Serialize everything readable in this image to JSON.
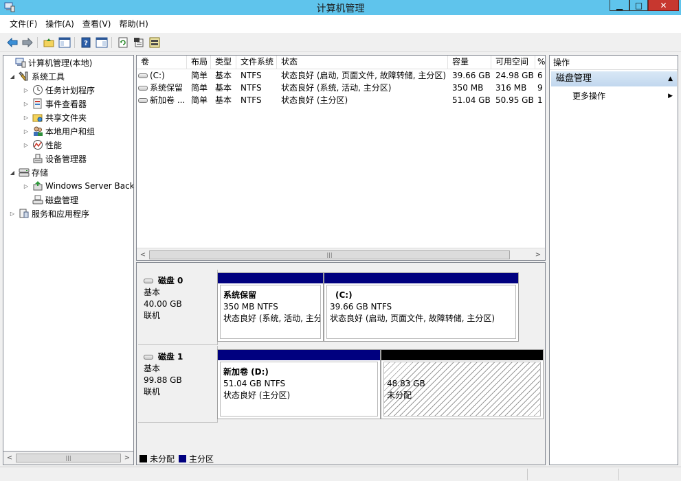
{
  "window": {
    "title": "计算机管理"
  },
  "menu": [
    "文件(F)",
    "操作(A)",
    "查看(V)",
    "帮助(H)"
  ],
  "tree": {
    "items": [
      {
        "label": "计算机管理(本地)",
        "level": 0,
        "expander": "",
        "icon": "computer-management-icon"
      },
      {
        "label": "系统工具",
        "level": 1,
        "expander": "◢",
        "icon": "system-tools-icon"
      },
      {
        "label": "任务计划程序",
        "level": 2,
        "expander": "▷",
        "icon": "task-scheduler-icon"
      },
      {
        "label": "事件查看器",
        "level": 2,
        "expander": "▷",
        "icon": "event-viewer-icon"
      },
      {
        "label": "共享文件夹",
        "level": 2,
        "expander": "▷",
        "icon": "shared-folders-icon"
      },
      {
        "label": "本地用户和组",
        "level": 2,
        "expander": "▷",
        "icon": "local-users-icon"
      },
      {
        "label": "性能",
        "level": 2,
        "expander": "▷",
        "icon": "performance-icon"
      },
      {
        "label": "设备管理器",
        "level": 2,
        "expander": "",
        "icon": "device-manager-icon"
      },
      {
        "label": "存储",
        "level": 1,
        "expander": "◢",
        "icon": "storage-icon"
      },
      {
        "label": "Windows Server Back",
        "level": 2,
        "expander": "▷",
        "icon": "windows-server-backup-icon"
      },
      {
        "label": "磁盘管理",
        "level": 2,
        "expander": "",
        "icon": "disk-management-icon",
        "selected": true
      },
      {
        "label": "服务和应用程序",
        "level": 1,
        "expander": "▷",
        "icon": "services-applications-icon"
      }
    ]
  },
  "volumes": {
    "columns": [
      "卷",
      "布局",
      "类型",
      "文件系统",
      "状态",
      "容量",
      "可用空间",
      "%"
    ],
    "rows": [
      [
        "(C:)",
        "简单",
        "基本",
        "NTFS",
        "状态良好 (启动, 页面文件, 故障转储, 主分区)",
        "39.66 GB",
        "24.98 GB",
        "6"
      ],
      [
        "系统保留",
        "简单",
        "基本",
        "NTFS",
        "状态良好 (系统, 活动, 主分区)",
        "350 MB",
        "316 MB",
        "9"
      ],
      [
        "新加卷 ...",
        "简单",
        "基本",
        "NTFS",
        "状态良好 (主分区)",
        "51.04 GB",
        "50.95 GB",
        "1"
      ]
    ]
  },
  "disks": [
    {
      "name": "磁盘 0",
      "type": "基本",
      "size": "40.00 GB",
      "status": "联机",
      "partitions": [
        {
          "name": "系统保留",
          "size": "350 MB NTFS",
          "status": "状态良好 (系统, 活动, 主分",
          "kind": "primary"
        },
        {
          "name": "(C:)",
          "size": "39.66 GB NTFS",
          "status": "状态良好 (启动, 页面文件, 故障转储, 主分区)",
          "kind": "primary"
        }
      ]
    },
    {
      "name": "磁盘 1",
      "type": "基本",
      "size": "99.88 GB",
      "status": "联机",
      "partitions": [
        {
          "name": "新加卷  (D:)",
          "size": "51.04 GB NTFS",
          "status": "状态良好 (主分区)",
          "kind": "primary"
        },
        {
          "name": "",
          "size": "48.83 GB",
          "status": "未分配",
          "kind": "unallocated"
        }
      ]
    }
  ],
  "legend": [
    {
      "label": "未分配",
      "color": "#000000"
    },
    {
      "label": "主分区",
      "color": "#00007f"
    }
  ],
  "actions": {
    "title": "操作",
    "group": "磁盘管理",
    "more": "更多操作"
  },
  "colors": {
    "titlebar": "#5fc4ec",
    "primary_partition": "#00007f",
    "unallocated": "#000000",
    "actions_header": "#c1d7ee"
  }
}
